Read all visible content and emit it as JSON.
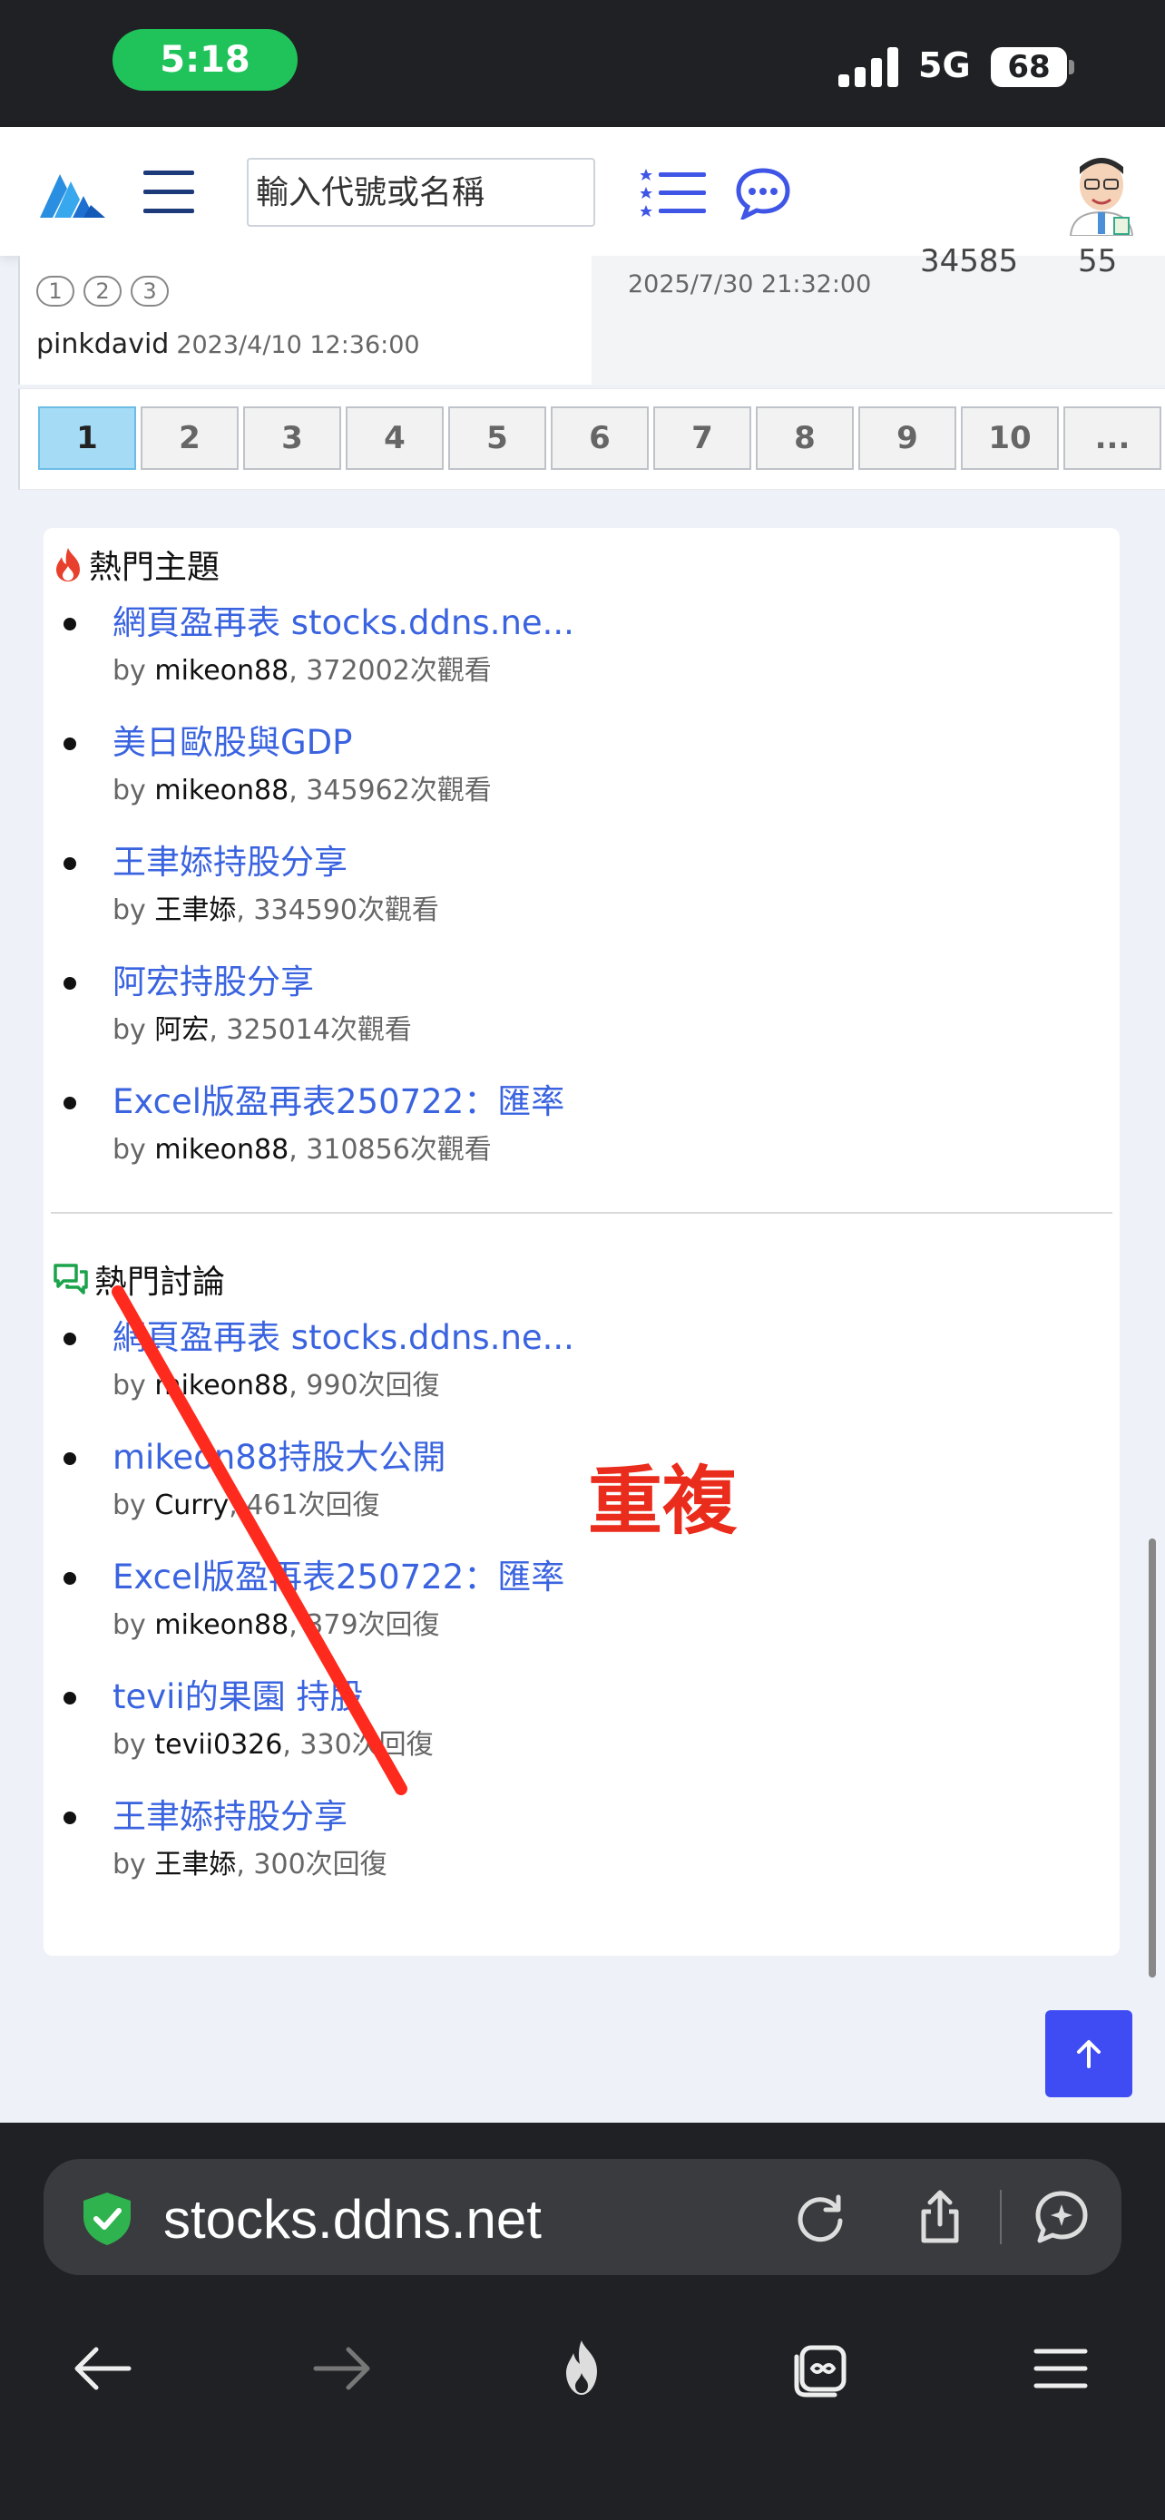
{
  "status_bar": {
    "time": "5:18",
    "network": "5G",
    "battery": "68"
  },
  "header": {
    "search_placeholder": "輸入代號或名稱"
  },
  "previous_row": {
    "page_links": [
      "1",
      "2",
      "3"
    ],
    "author": "pinkdavid",
    "posted": "2023/4/10 12:36:00",
    "last_post": "2025/7/30 21:32:00",
    "count_a": "34585",
    "count_b": "55"
  },
  "pagination": {
    "pages": [
      "1",
      "2",
      "3",
      "4",
      "5",
      "6",
      "7",
      "8",
      "9",
      "10",
      "..."
    ],
    "active": "1"
  },
  "hot_topics": {
    "title": "熱門主題",
    "items": [
      {
        "title": "網頁盈再表 stocks.ddns.ne...",
        "by": "by",
        "author": "mikeon88",
        "stat": ", 372002次觀看"
      },
      {
        "title": "美日歐股與GDP",
        "by": "by",
        "author": "mikeon88",
        "stat": ", 345962次觀看"
      },
      {
        "title": "王聿婖持股分享",
        "by": "by",
        "author": "王聿婖",
        "stat": ", 334590次觀看"
      },
      {
        "title": "阿宏持股分享",
        "by": "by",
        "author": "阿宏",
        "stat": ", 325014次觀看"
      },
      {
        "title": "Excel版盈再表250722：匯率",
        "by": "by",
        "author": "mikeon88",
        "stat": ", 310856次觀看"
      }
    ]
  },
  "hot_discussions": {
    "title": "熱門討論",
    "items": [
      {
        "title": "網頁盈再表 stocks.ddns.ne...",
        "by": "by",
        "author": "mikeon88",
        "stat": ", 990次回復"
      },
      {
        "title": "mikeon88持股大公開",
        "by": "by",
        "author": "Curry",
        "stat": ", 461次回復"
      },
      {
        "title": "Excel版盈再表250722：匯率",
        "by": "by",
        "author": "mikeon88",
        "stat": ", 379次回復"
      },
      {
        "title": "tevii的果園 持股",
        "by": "by",
        "author": "tevii0326",
        "stat": ", 330次回復"
      },
      {
        "title": "王聿婖持股分享",
        "by": "by",
        "author": "王聿婖",
        "stat": ", 300次回復"
      }
    ]
  },
  "annotation": {
    "text": "重複",
    "color": "#ea2c1c"
  },
  "browser": {
    "url": "stocks.ddns.net"
  },
  "colors": {
    "link": "#3a63e0",
    "accent_button": "#3f4cf3",
    "active_page": "#a6dbf5"
  }
}
